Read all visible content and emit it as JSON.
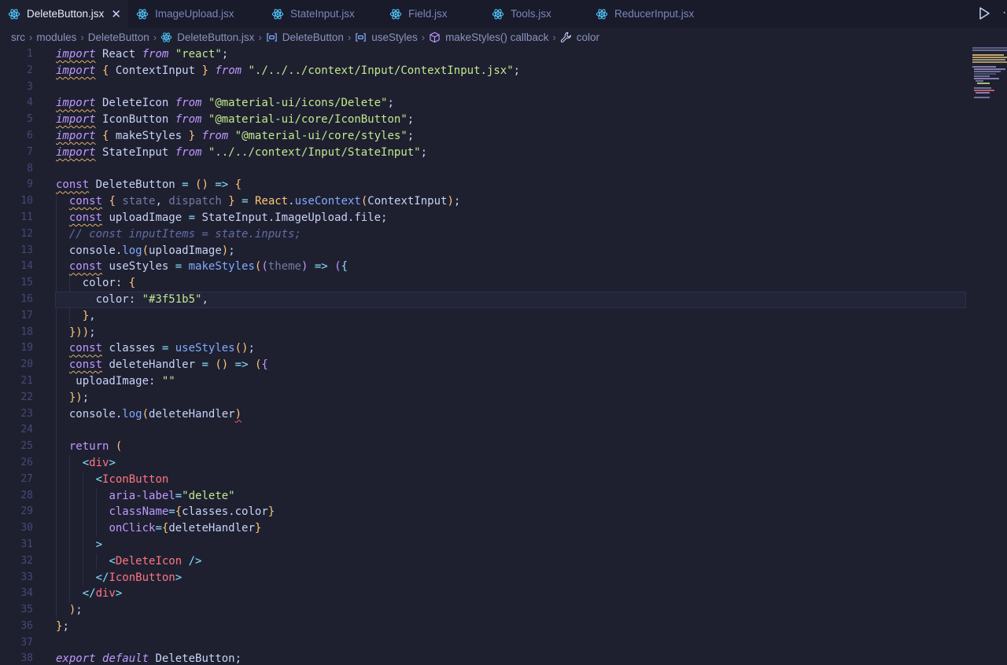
{
  "tabs": [
    {
      "label": "DeleteButton.jsx",
      "active": true
    },
    {
      "label": "ImageUpload.jsx",
      "active": false
    },
    {
      "label": "StateInput.jsx",
      "active": false
    },
    {
      "label": "Field.jsx",
      "active": false
    },
    {
      "label": "Tools.jsx",
      "active": false
    },
    {
      "label": "ReducerInput.jsx",
      "active": false
    }
  ],
  "tab_close_glyph": "✕",
  "breadcrumb": {
    "src": "src",
    "modules": "modules",
    "folder": "DeleteButton",
    "file": "DeleteButton.jsx",
    "component": "DeleteButton",
    "hook": "useStyles",
    "callback": "makeStyles() callback",
    "prop": "color"
  },
  "editor": {
    "current_line": 16,
    "lines": [
      [
        "import React from \"react\";"
      ],
      [
        "import { ContextInput } from \"./../../context/Input/ContextInput.jsx\";"
      ],
      [
        ""
      ],
      [
        "import DeleteIcon from \"@material-ui/icons/Delete\";"
      ],
      [
        "import IconButton from \"@material-ui/core/IconButton\";"
      ],
      [
        "import { makeStyles } from \"@material-ui/core/styles\";"
      ],
      [
        "import StateInput from \"../../context/Input/StateInput\";"
      ],
      [
        ""
      ],
      [
        "const DeleteButton = () => {"
      ],
      [
        "  const { state, dispatch } = React.useContext(ContextInput);"
      ],
      [
        "  const uploadImage = StateInput.ImageUpload.file;"
      ],
      [
        "  // const inputItems = state.inputs;"
      ],
      [
        "  console.log(uploadImage);"
      ],
      [
        "  const useStyles = makeStyles((theme) => ({"
      ],
      [
        "    color: {"
      ],
      [
        "      color: \"#3f51b5\","
      ],
      [
        "    },"
      ],
      [
        "  }));"
      ],
      [
        "  const classes = useStyles();"
      ],
      [
        "  const deleteHandler = () => ({"
      ],
      [
        "   uploadImage: \"\""
      ],
      [
        "  });"
      ],
      [
        "  console.log(deleteHandler)"
      ],
      [
        ""
      ],
      [
        "  return ("
      ],
      [
        "    <div>"
      ],
      [
        "      <IconButton"
      ],
      [
        "        aria-label=\"delete\""
      ],
      [
        "        className={classes.color}"
      ],
      [
        "        onClick={deleteHandler}"
      ],
      [
        "      >"
      ],
      [
        "        <DeleteIcon />"
      ],
      [
        "      </IconButton>"
      ],
      [
        "    </div>"
      ],
      [
        "  );"
      ],
      [
        "};"
      ],
      [
        ""
      ],
      [
        "export default DeleteButton;"
      ]
    ]
  },
  "colors": {
    "background": "#1e2030",
    "tabbar": "#191a2a",
    "keyword": "#c099ff",
    "string": "#c3e88d",
    "function": "#82aaff",
    "tag": "#ff757f",
    "react_icon": "#4fc3f7"
  }
}
